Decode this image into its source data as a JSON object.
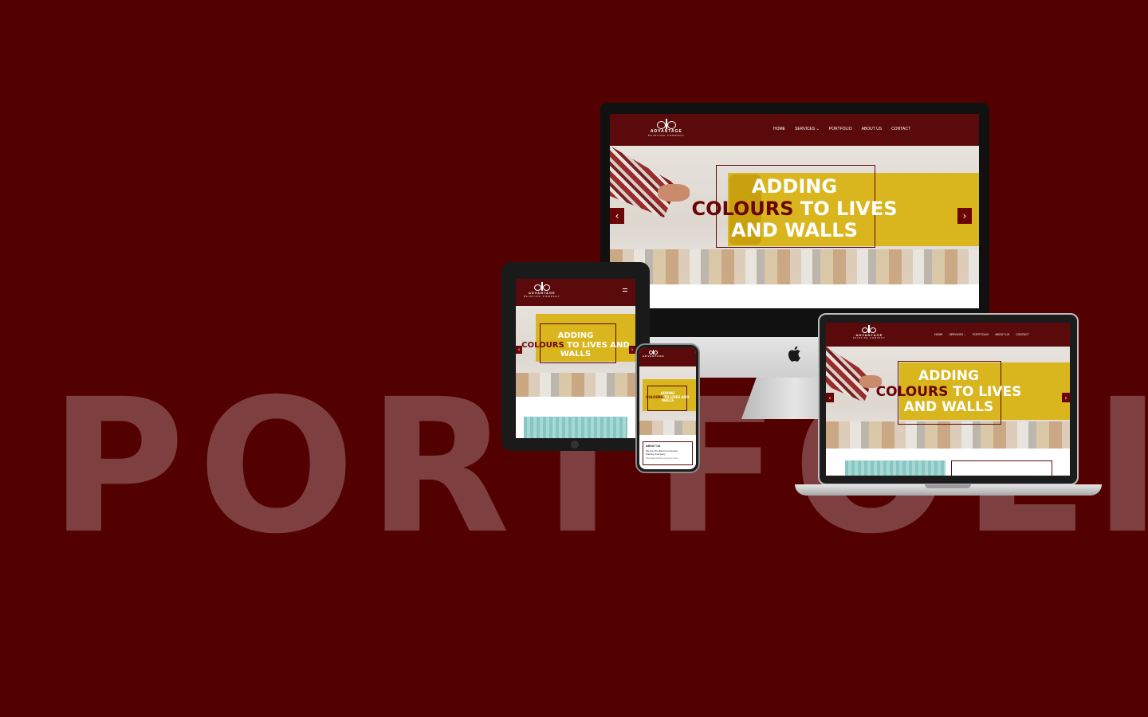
{
  "background_text": "PORTFOLIO",
  "colors": {
    "background": "#520000",
    "brand_dark": "#5a0a0a",
    "accent_text": "#6a0505",
    "paint_yellow": "#d9b51e"
  },
  "logo": {
    "name": "ADVANTAGE",
    "sub": "PAINTING COMPANY"
  },
  "nav": {
    "home": "HOME",
    "services": "SERVICES ⌄",
    "portfolio": "PORTFOLIO",
    "about": "ABOUT US",
    "contact": "CONTACT"
  },
  "hero": {
    "line1": "ADDING",
    "accent": "COLOURS",
    "line2_rest": " TO LIVES",
    "line3": "AND WALLS",
    "lives_and": " TO LIVES AND",
    "walls": "WALLS",
    "to_lives_and": "TO LIVES AND"
  },
  "arrows": {
    "prev": "‹",
    "next": "›"
  },
  "phone_about": {
    "title": "ABOUT US",
    "line1": "We Are The Best Commercial",
    "line2": "Painting Company",
    "line3": "Advantage Painting Company works"
  },
  "icons": {
    "menu": "hamburger-icon",
    "apple": "apple-logo-icon"
  }
}
